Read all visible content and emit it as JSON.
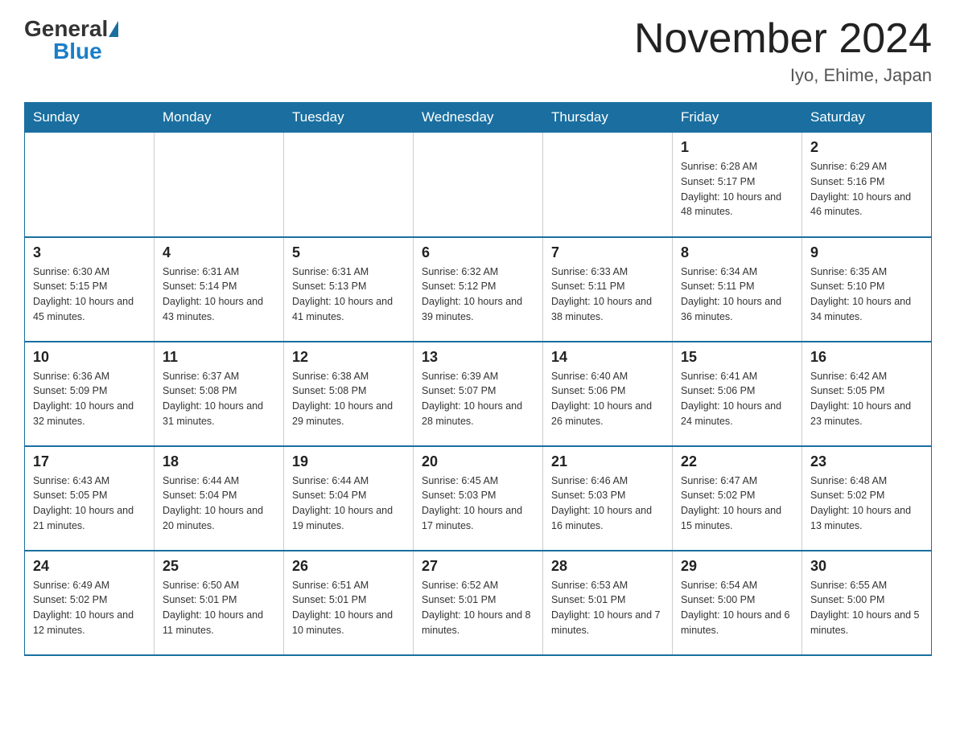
{
  "logo": {
    "general": "General",
    "blue": "Blue"
  },
  "header": {
    "month": "November 2024",
    "location": "Iyo, Ehime, Japan"
  },
  "weekdays": [
    "Sunday",
    "Monday",
    "Tuesday",
    "Wednesday",
    "Thursday",
    "Friday",
    "Saturday"
  ],
  "weeks": [
    [
      {
        "day": "",
        "info": ""
      },
      {
        "day": "",
        "info": ""
      },
      {
        "day": "",
        "info": ""
      },
      {
        "day": "",
        "info": ""
      },
      {
        "day": "",
        "info": ""
      },
      {
        "day": "1",
        "info": "Sunrise: 6:28 AM\nSunset: 5:17 PM\nDaylight: 10 hours and 48 minutes."
      },
      {
        "day": "2",
        "info": "Sunrise: 6:29 AM\nSunset: 5:16 PM\nDaylight: 10 hours and 46 minutes."
      }
    ],
    [
      {
        "day": "3",
        "info": "Sunrise: 6:30 AM\nSunset: 5:15 PM\nDaylight: 10 hours and 45 minutes."
      },
      {
        "day": "4",
        "info": "Sunrise: 6:31 AM\nSunset: 5:14 PM\nDaylight: 10 hours and 43 minutes."
      },
      {
        "day": "5",
        "info": "Sunrise: 6:31 AM\nSunset: 5:13 PM\nDaylight: 10 hours and 41 minutes."
      },
      {
        "day": "6",
        "info": "Sunrise: 6:32 AM\nSunset: 5:12 PM\nDaylight: 10 hours and 39 minutes."
      },
      {
        "day": "7",
        "info": "Sunrise: 6:33 AM\nSunset: 5:11 PM\nDaylight: 10 hours and 38 minutes."
      },
      {
        "day": "8",
        "info": "Sunrise: 6:34 AM\nSunset: 5:11 PM\nDaylight: 10 hours and 36 minutes."
      },
      {
        "day": "9",
        "info": "Sunrise: 6:35 AM\nSunset: 5:10 PM\nDaylight: 10 hours and 34 minutes."
      }
    ],
    [
      {
        "day": "10",
        "info": "Sunrise: 6:36 AM\nSunset: 5:09 PM\nDaylight: 10 hours and 32 minutes."
      },
      {
        "day": "11",
        "info": "Sunrise: 6:37 AM\nSunset: 5:08 PM\nDaylight: 10 hours and 31 minutes."
      },
      {
        "day": "12",
        "info": "Sunrise: 6:38 AM\nSunset: 5:08 PM\nDaylight: 10 hours and 29 minutes."
      },
      {
        "day": "13",
        "info": "Sunrise: 6:39 AM\nSunset: 5:07 PM\nDaylight: 10 hours and 28 minutes."
      },
      {
        "day": "14",
        "info": "Sunrise: 6:40 AM\nSunset: 5:06 PM\nDaylight: 10 hours and 26 minutes."
      },
      {
        "day": "15",
        "info": "Sunrise: 6:41 AM\nSunset: 5:06 PM\nDaylight: 10 hours and 24 minutes."
      },
      {
        "day": "16",
        "info": "Sunrise: 6:42 AM\nSunset: 5:05 PM\nDaylight: 10 hours and 23 minutes."
      }
    ],
    [
      {
        "day": "17",
        "info": "Sunrise: 6:43 AM\nSunset: 5:05 PM\nDaylight: 10 hours and 21 minutes."
      },
      {
        "day": "18",
        "info": "Sunrise: 6:44 AM\nSunset: 5:04 PM\nDaylight: 10 hours and 20 minutes."
      },
      {
        "day": "19",
        "info": "Sunrise: 6:44 AM\nSunset: 5:04 PM\nDaylight: 10 hours and 19 minutes."
      },
      {
        "day": "20",
        "info": "Sunrise: 6:45 AM\nSunset: 5:03 PM\nDaylight: 10 hours and 17 minutes."
      },
      {
        "day": "21",
        "info": "Sunrise: 6:46 AM\nSunset: 5:03 PM\nDaylight: 10 hours and 16 minutes."
      },
      {
        "day": "22",
        "info": "Sunrise: 6:47 AM\nSunset: 5:02 PM\nDaylight: 10 hours and 15 minutes."
      },
      {
        "day": "23",
        "info": "Sunrise: 6:48 AM\nSunset: 5:02 PM\nDaylight: 10 hours and 13 minutes."
      }
    ],
    [
      {
        "day": "24",
        "info": "Sunrise: 6:49 AM\nSunset: 5:02 PM\nDaylight: 10 hours and 12 minutes."
      },
      {
        "day": "25",
        "info": "Sunrise: 6:50 AM\nSunset: 5:01 PM\nDaylight: 10 hours and 11 minutes."
      },
      {
        "day": "26",
        "info": "Sunrise: 6:51 AM\nSunset: 5:01 PM\nDaylight: 10 hours and 10 minutes."
      },
      {
        "day": "27",
        "info": "Sunrise: 6:52 AM\nSunset: 5:01 PM\nDaylight: 10 hours and 8 minutes."
      },
      {
        "day": "28",
        "info": "Sunrise: 6:53 AM\nSunset: 5:01 PM\nDaylight: 10 hours and 7 minutes."
      },
      {
        "day": "29",
        "info": "Sunrise: 6:54 AM\nSunset: 5:00 PM\nDaylight: 10 hours and 6 minutes."
      },
      {
        "day": "30",
        "info": "Sunrise: 6:55 AM\nSunset: 5:00 PM\nDaylight: 10 hours and 5 minutes."
      }
    ]
  ]
}
